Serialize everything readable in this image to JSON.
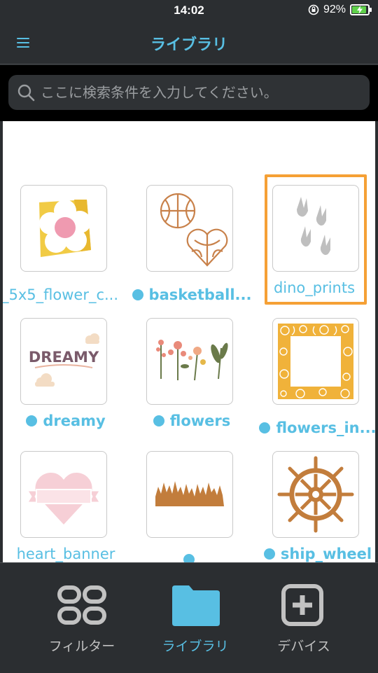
{
  "status": {
    "time": "14:02",
    "battery": "92%"
  },
  "header": {
    "title": "ライブラリ"
  },
  "search": {
    "placeholder": "ここに検索条件を入力してください。"
  },
  "items": [
    {
      "label": "_5x5_flower_c...",
      "dot": false,
      "selected": false
    },
    {
      "label": "basketball...",
      "dot": true,
      "selected": false
    },
    {
      "label": "dino_prints",
      "dot": false,
      "selected": true
    },
    {
      "label": "dreamy",
      "dot": true,
      "selected": false
    },
    {
      "label": "flowers",
      "dot": true,
      "selected": false
    },
    {
      "label": "flowers_in...",
      "dot": true,
      "selected": false
    },
    {
      "label": "heart_banner",
      "dot": false,
      "selected": false
    },
    {
      "label": "",
      "dot": true,
      "selected": false
    },
    {
      "label": "ship_wheel",
      "dot": true,
      "selected": false
    }
  ],
  "dreamy_text": "DREAMY",
  "tabs": [
    {
      "label": "フィルター",
      "icon": "filter-icon",
      "active": false
    },
    {
      "label": "ライブラリ",
      "icon": "folder-icon",
      "active": true
    },
    {
      "label": "デバイス",
      "icon": "device-add-icon",
      "active": false
    }
  ],
  "colors": {
    "accent": "#58bfe3",
    "selection": "#f5a035",
    "bar": "#2b2e31"
  }
}
